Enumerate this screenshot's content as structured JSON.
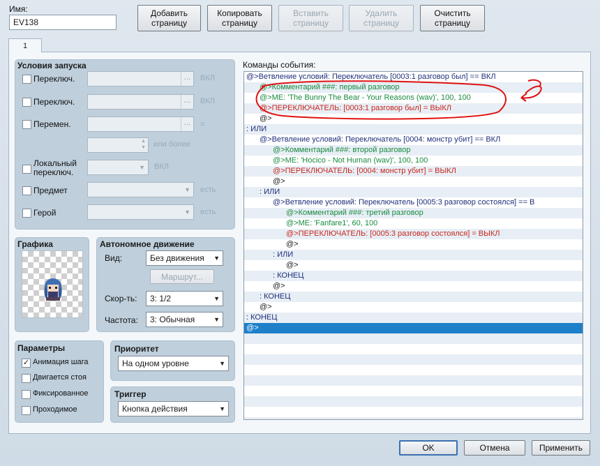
{
  "header": {
    "name_label": "Имя:",
    "name_value": "EV138",
    "buttons": {
      "add": "Добавить страницу",
      "copy": "Копировать страницу",
      "insert": "Вставить страницу",
      "delete": "Удалить страницу",
      "clear": "Очистить страницу"
    }
  },
  "tabs": [
    "1"
  ],
  "conditions": {
    "title": "Условия запуска",
    "switch1_label": "Переключ.",
    "switch2_label": "Переключ.",
    "variable_label": "Перемен.",
    "self_switch_label": "Локальный переключ.",
    "item_label": "Предмет",
    "actor_label": "Герой",
    "on_suffix_1": "ВКЛ",
    "on_suffix_2": "ВКЛ",
    "on_suffix_3": "ВКЛ",
    "equals_suffix": "=",
    "or_more_suffix": "или более",
    "has_suffix_1": "есть",
    "has_suffix_2": "есть",
    "dots": "…"
  },
  "graphic": {
    "title": "Графика"
  },
  "autonomous": {
    "title": "Автономное движение",
    "type_label": "Вид:",
    "type_value": "Без движения",
    "route_button": "Маршрут...",
    "speed_label": "Скор-ть:",
    "speed_value": "3: 1/2",
    "freq_label": "Частота:",
    "freq_value": "3: Обычная"
  },
  "options": {
    "title": "Параметры",
    "items": [
      {
        "label": "Анимация шага",
        "checked": true
      },
      {
        "label": "Двигается стоя",
        "checked": false
      },
      {
        "label": "Фиксированное",
        "checked": false
      },
      {
        "label": "Проходимое",
        "checked": false
      }
    ]
  },
  "priority": {
    "title": "Приоритет",
    "value": "На одном уровне"
  },
  "trigger": {
    "title": "Триггер",
    "value": "Кнопка действия"
  },
  "commands": {
    "title": "Команды события:",
    "rows": [
      {
        "indent": 0,
        "color": "blue",
        "text": "@>Ветвление условий: Переключатель [0003:1 разговор был] == ВКЛ"
      },
      {
        "indent": 1,
        "color": "green",
        "text": "@>Комментарий ###: первый разговор"
      },
      {
        "indent": 1,
        "color": "green",
        "text": "@>ME: 'The Bunny The Bear - Your Reasons (wav)', 100, 100"
      },
      {
        "indent": 1,
        "color": "red",
        "text": "@>ПЕРЕКЛЮЧАТЕЛЬ: [0003:1 разговор был] = ВЫКЛ"
      },
      {
        "indent": 1,
        "color": "plain",
        "text": "@>"
      },
      {
        "indent": 0,
        "color": "blue",
        "text": ": ИЛИ"
      },
      {
        "indent": 1,
        "color": "blue",
        "text": "@>Ветвление условий: Переключатель [0004: монстр убит] == ВКЛ"
      },
      {
        "indent": 2,
        "color": "green",
        "text": "@>Комментарий ###: второй разговор"
      },
      {
        "indent": 2,
        "color": "green",
        "text": "@>ME: 'Hocico - Not Human (wav)', 100, 100"
      },
      {
        "indent": 2,
        "color": "red",
        "text": "@>ПЕРЕКЛЮЧАТЕЛЬ: [0004: монстр убит] = ВЫКЛ"
      },
      {
        "indent": 2,
        "color": "plain",
        "text": "@>"
      },
      {
        "indent": 1,
        "color": "blue",
        "text": ": ИЛИ"
      },
      {
        "indent": 2,
        "color": "blue",
        "text": "@>Ветвление условий: Переключатель [0005:3 разговор состоялся] == В"
      },
      {
        "indent": 3,
        "color": "green",
        "text": "@>Комментарий ###: третий разговор"
      },
      {
        "indent": 3,
        "color": "green",
        "text": "@>ME: 'Fanfare1', 60, 100"
      },
      {
        "indent": 3,
        "color": "red",
        "text": "@>ПЕРЕКЛЮЧАТЕЛЬ: [0005:3 разговор состоялся] = ВЫКЛ"
      },
      {
        "indent": 3,
        "color": "plain",
        "text": "@>"
      },
      {
        "indent": 2,
        "color": "blue",
        "text": ": ИЛИ"
      },
      {
        "indent": 3,
        "color": "plain",
        "text": "@>"
      },
      {
        "indent": 2,
        "color": "blue",
        "text": ": КОНЕЦ"
      },
      {
        "indent": 2,
        "color": "plain",
        "text": "@>"
      },
      {
        "indent": 1,
        "color": "blue",
        "text": ": КОНЕЦ"
      },
      {
        "indent": 1,
        "color": "plain",
        "text": "@>"
      },
      {
        "indent": 0,
        "color": "blue",
        "text": ": КОНЕЦ"
      },
      {
        "indent": 0,
        "color": "sel",
        "text": "@>"
      }
    ],
    "empty_rows": 9
  },
  "footer": {
    "ok": "OK",
    "cancel": "Отмена",
    "apply": "Применить"
  },
  "colors": {
    "blue": "#1f2f7a",
    "green": "#198a3e",
    "red": "#c8261d",
    "selection": "#1d80c9",
    "annotation": "#e01010"
  }
}
